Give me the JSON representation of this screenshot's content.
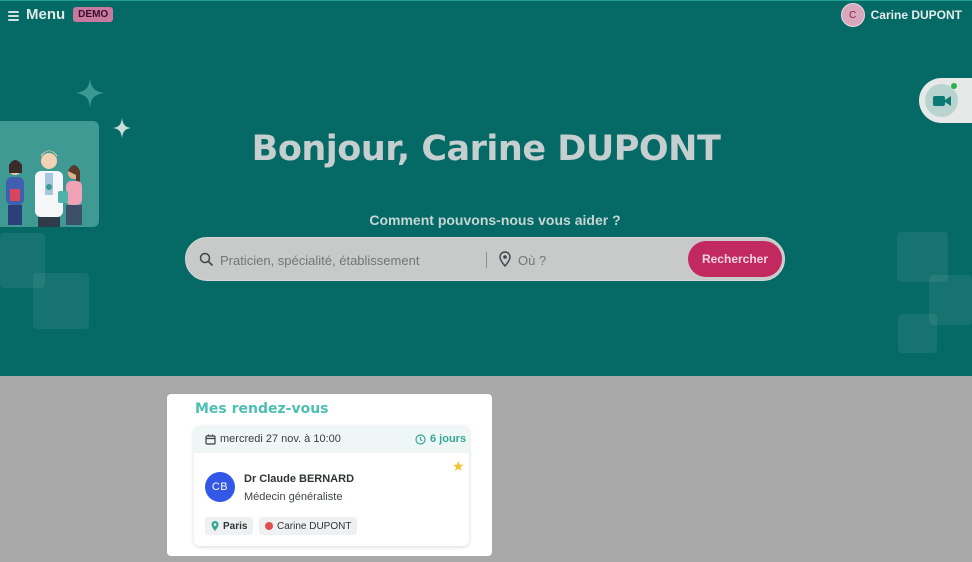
{
  "header": {
    "menu_label": "Menu",
    "demo_badge": "DEMO",
    "user": {
      "initial": "C",
      "name": "Carine DUPONT"
    }
  },
  "hero": {
    "greeting": "Bonjour, Carine DUPONT",
    "help_text": "Comment pouvons-nous vous aider ?",
    "search": {
      "query_placeholder": "Praticien, spécialité, établissement",
      "location_placeholder": "Où ?",
      "button_label": "Rechercher"
    }
  },
  "appointments": {
    "title": "Mes rendez-vous",
    "items": [
      {
        "date": "mercredi 27 nov. à 10:00",
        "countdown": "6 jours",
        "doctor_initials": "CB",
        "doctor_name": "Dr Claude BERNARD",
        "specialty": "Médecin généraliste",
        "city": "Paris",
        "patient": "Carine DUPONT",
        "favorite": true
      }
    ]
  },
  "colors": {
    "hero_bg": "#056965",
    "accent_pink": "#c2295e",
    "accent_teal": "#4dbfb2",
    "doctor_avatar": "#3358e8"
  },
  "icons": [
    "hamburger-icon",
    "video-call-icon",
    "sparkle-icon",
    "search-icon",
    "location-pin-icon",
    "calendar-icon",
    "clock-icon",
    "star-icon"
  ]
}
